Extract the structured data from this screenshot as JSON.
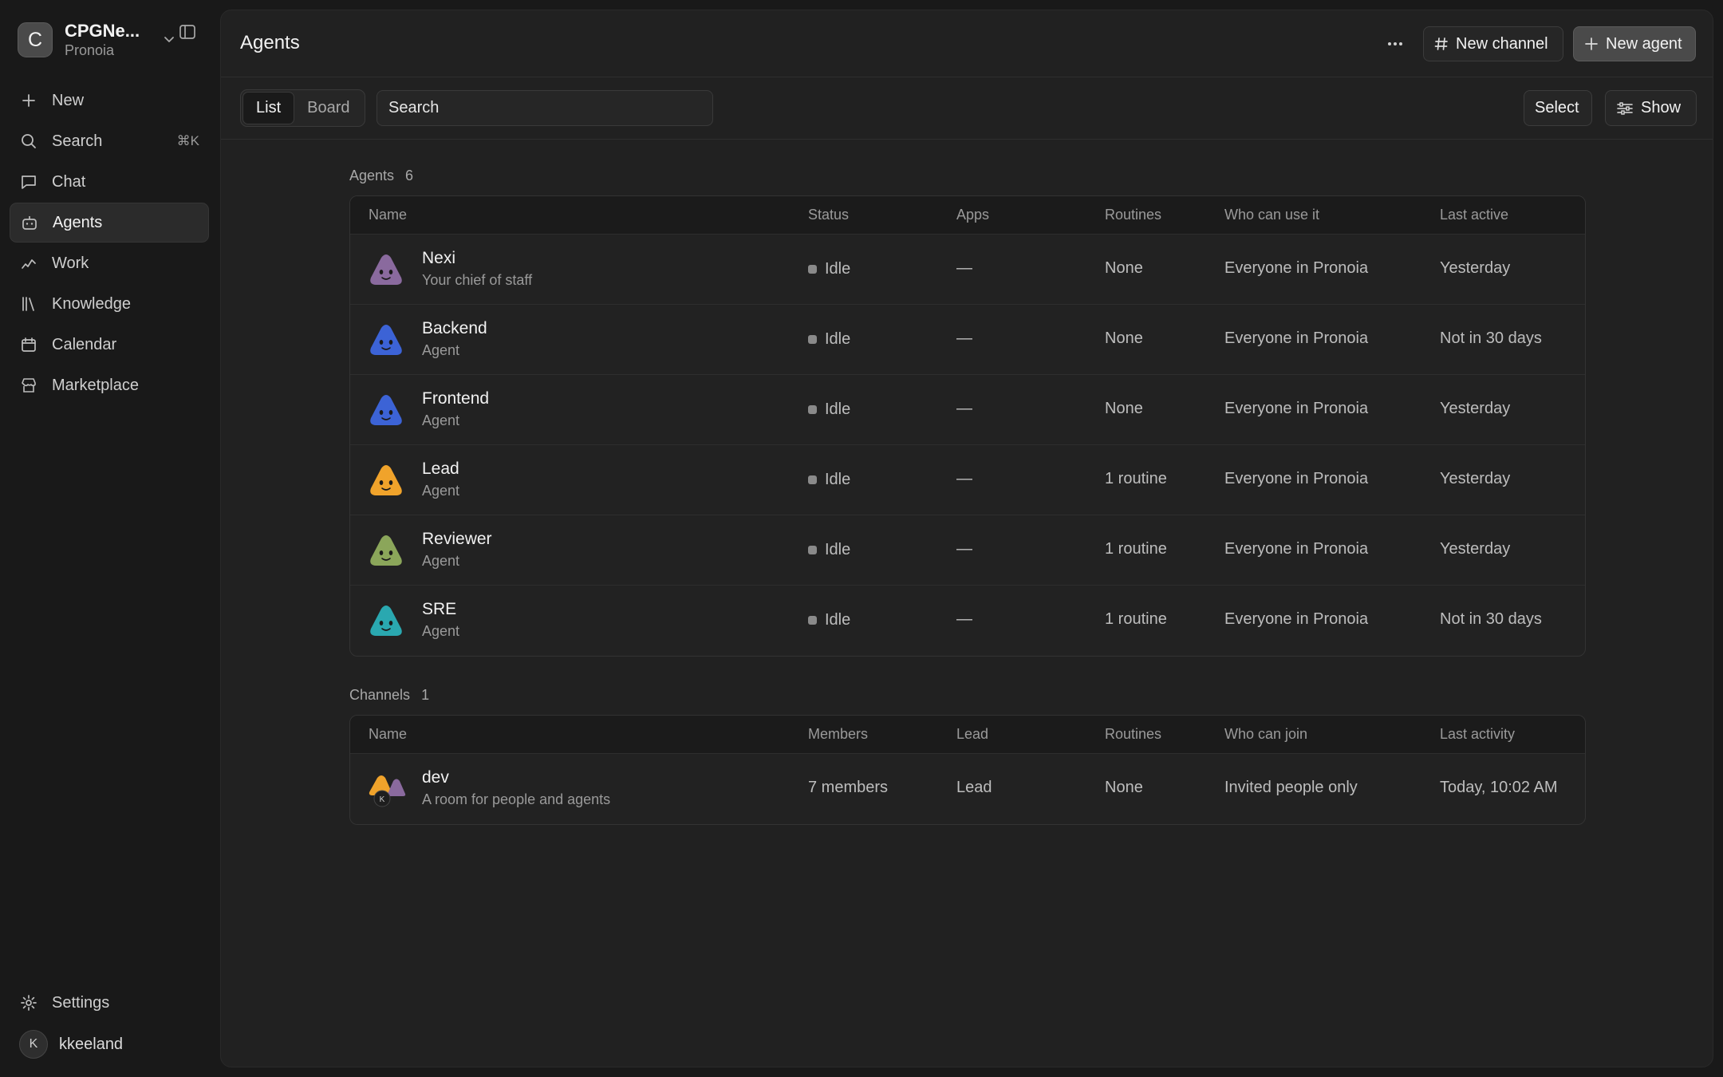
{
  "workspace": {
    "initial": "C",
    "name": "CPGNe...",
    "subtitle": "Pronoia"
  },
  "nav": [
    {
      "label": "New",
      "icon": "plus-icon"
    },
    {
      "label": "Search",
      "icon": "search-icon",
      "shortcut": "⌘K"
    },
    {
      "label": "Chat",
      "icon": "chat-icon"
    },
    {
      "label": "Agents",
      "icon": "bot-icon",
      "active": true
    },
    {
      "label": "Work",
      "icon": "work-icon"
    },
    {
      "label": "Knowledge",
      "icon": "library-icon"
    },
    {
      "label": "Calendar",
      "icon": "calendar-icon"
    },
    {
      "label": "Marketplace",
      "icon": "store-icon"
    }
  ],
  "settings_label": "Settings",
  "user": {
    "initial": "K",
    "name": "kkeeland"
  },
  "header": {
    "title": "Agents",
    "new_channel": "New channel",
    "new_agent": "New agent"
  },
  "toolbar": {
    "view_list": "List",
    "view_board": "Board",
    "search_placeholder": "Search",
    "select": "Select",
    "show": "Show"
  },
  "agents_section": {
    "label": "Agents",
    "count": "6",
    "columns": [
      "Name",
      "Status",
      "Apps",
      "Routines",
      "Who can use it",
      "Last active"
    ],
    "rows": [
      {
        "name": "Nexi",
        "desc": "Your chief of staff",
        "status": "Idle",
        "apps": "—",
        "routines": "None",
        "access": "Everyone in Pronoia",
        "last": "Yesterday",
        "color": "#8a6a9e"
      },
      {
        "name": "Backend",
        "desc": "Agent",
        "status": "Idle",
        "apps": "—",
        "routines": "None",
        "access": "Everyone in Pronoia",
        "last": "Not in 30 days",
        "color": "#3c63d6"
      },
      {
        "name": "Frontend",
        "desc": "Agent",
        "status": "Idle",
        "apps": "—",
        "routines": "None",
        "access": "Everyone in Pronoia",
        "last": "Yesterday",
        "color": "#3c63d6"
      },
      {
        "name": "Lead",
        "desc": "Agent",
        "status": "Idle",
        "apps": "—",
        "routines": "1 routine",
        "access": "Everyone in Pronoia",
        "last": "Yesterday",
        "color": "#f0a32b"
      },
      {
        "name": "Reviewer",
        "desc": "Agent",
        "status": "Idle",
        "apps": "—",
        "routines": "1 routine",
        "access": "Everyone in Pronoia",
        "last": "Yesterday",
        "color": "#8ba65a"
      },
      {
        "name": "SRE",
        "desc": "Agent",
        "status": "Idle",
        "apps": "—",
        "routines": "1 routine",
        "access": "Everyone in Pronoia",
        "last": "Not in 30 days",
        "color": "#2aa8b0"
      }
    ]
  },
  "channels_section": {
    "label": "Channels",
    "count": "1",
    "columns": [
      "Name",
      "Members",
      "Lead",
      "Routines",
      "Who can join",
      "Last activity"
    ],
    "rows": [
      {
        "name": "dev",
        "desc": "A room for people and agents",
        "members": "7 members",
        "lead": "Lead",
        "routines": "None",
        "access": "Invited people only",
        "last": "Today, 10:02 AM",
        "avatar_letter": "K"
      }
    ]
  }
}
